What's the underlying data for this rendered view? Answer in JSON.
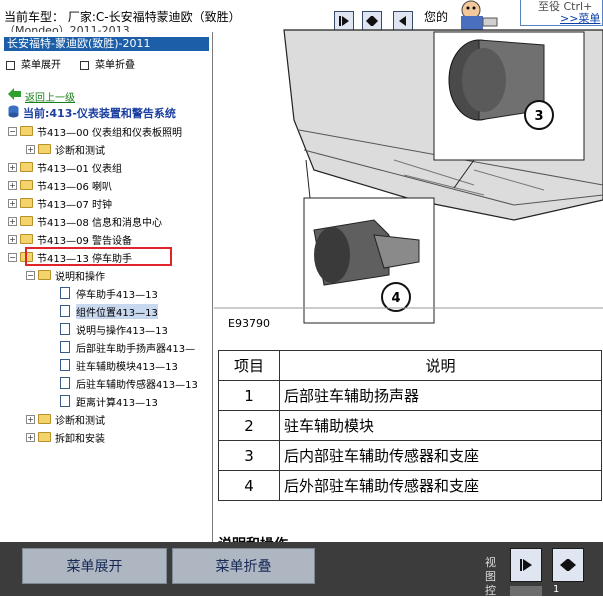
{
  "header": {
    "vehicle_title": "当前车型： 厂家:C-长安福特蒙迪欧（致胜）",
    "vehicle_title_2": "（Mondeo）2011-2013",
    "your_label": "您的",
    "promo_text": "至役 Ctrl+",
    "promo_link": ">>菜单"
  },
  "tree": {
    "model_bar": "长安福特-蒙迪欧(致胜)-2011",
    "expand_menu": "菜单展开",
    "collapse_menu": "菜单折叠",
    "back": "返回上一级",
    "current": "当前:413-仪表装置和警告系统",
    "sections": [
      {
        "label": "节413—00 仪表组和仪表板照明"
      },
      {
        "label": "诊断和测试"
      },
      {
        "label": "节413—01 仪表组"
      },
      {
        "label": "节413—06 喇叭"
      },
      {
        "label": "节413—07 时钟"
      },
      {
        "label": "节413—08 信息和消息中心"
      },
      {
        "label": "节413—09 警告设备"
      },
      {
        "label": "节413—13 停车助手"
      },
      {
        "label": "说明和操作"
      },
      {
        "label": "停车助手413—13"
      },
      {
        "label": "组件位置413—13"
      },
      {
        "label": "说明与操作413—13"
      },
      {
        "label": "后部驻车助手扬声器413—"
      },
      {
        "label": "驻车辅助模块413—13"
      },
      {
        "label": "后驻车辅助传感器413—13"
      },
      {
        "label": "距离计算413—13"
      },
      {
        "label": "诊断和测试"
      },
      {
        "label": "拆卸和安装"
      }
    ]
  },
  "diagram": {
    "fig_id": "E93790",
    "callouts": [
      "3",
      "4"
    ]
  },
  "legend_table": {
    "headers": [
      "项目",
      "说明"
    ],
    "rows": [
      {
        "num": "1",
        "desc": "后部驻车辅助扬声器"
      },
      {
        "num": "2",
        "desc": "驻车辅助模块"
      },
      {
        "num": "3",
        "desc": "后内部驻车辅助传感器和支座"
      },
      {
        "num": "4",
        "desc": "后外部驻车辅助传感器和支座"
      }
    ]
  },
  "partial_heading": "说明和操作",
  "bottom": {
    "expand_button": "菜单展开",
    "collapse_button": "菜单折叠",
    "view_label": "视图控",
    "small_text": "1"
  }
}
